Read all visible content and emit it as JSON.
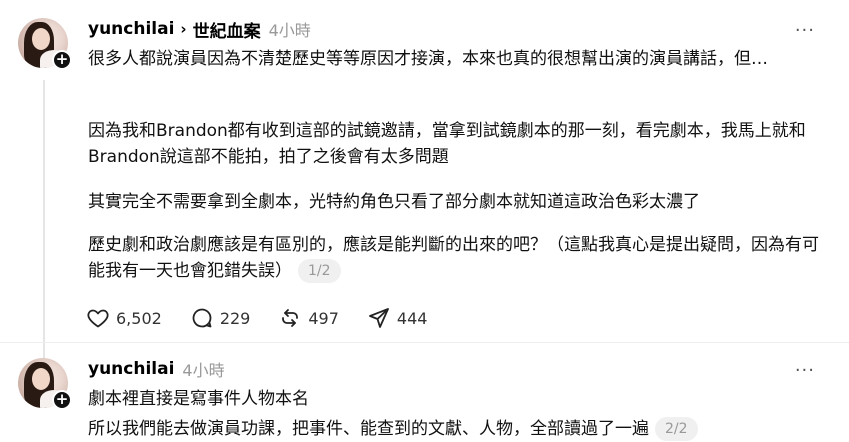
{
  "posts": [
    {
      "username": "yunchilai",
      "chevron": "›",
      "topic": "世紀血案",
      "time": "4小時",
      "more": "···",
      "paragraphs": [
        "很多人都說演員因為不清楚歷史等等原因才接演，本來也真的很想幫出演的演員講話，但…",
        "因為我和Brandon都有收到這部的試鏡邀請，當拿到試鏡劇本的那一刻，看完劇本，我馬上就和Brandon說這部不能拍，拍了之後會有太多問題",
        "其實完全不需要拿到全劇本，光特約角色只看了部分劇本就知道這政治色彩太濃了",
        "歷史劇和政治劇應該是有區別的，應該是能判斷的出來的吧？（這點我真心是提出疑問，因為有可能我有一天也會犯錯失誤）"
      ],
      "pager": "1/2",
      "actions": {
        "likes": "6,502",
        "comments": "229",
        "reposts": "497",
        "shares": "444"
      }
    },
    {
      "username": "yunchilai",
      "time": "4小時",
      "more": "···",
      "paragraphs": [
        "劇本裡直接是寫事件人物本名",
        "所以我們能去做演員功課，把事件、能查到的文獻、人物，全部讀過了一遍"
      ],
      "pager": "2/2"
    }
  ],
  "icons": {
    "like": "heart-icon",
    "comment": "comment-icon",
    "repost": "repost-icon",
    "share": "send-icon",
    "follow": "plus-icon"
  }
}
